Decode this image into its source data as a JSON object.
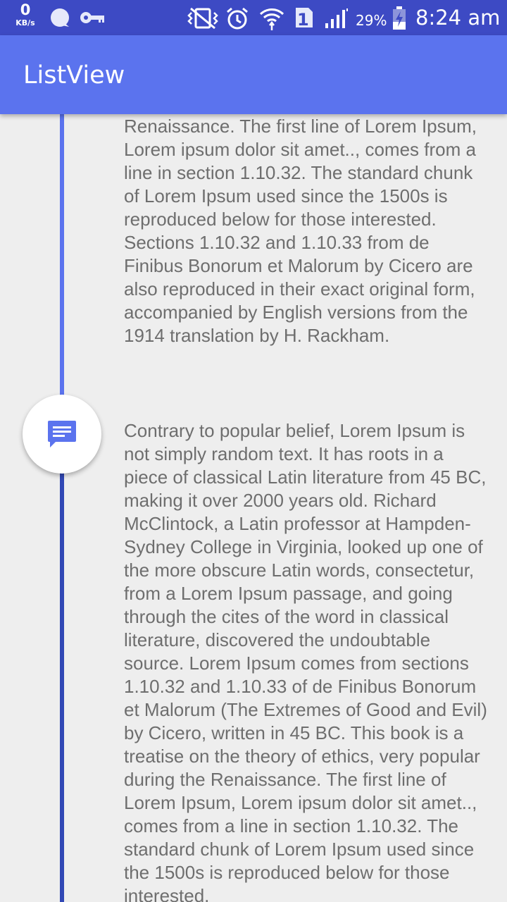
{
  "status_bar": {
    "net_speed": "0",
    "net_speed_unit": "KB/s",
    "sim_slot": "1",
    "battery_percent": "29%",
    "time": "8:24 am",
    "icons": [
      "chat-bubble-icon",
      "key-icon",
      "vibrate-icon",
      "alarm-icon",
      "wifi-icon",
      "sim-icon",
      "signal-icon",
      "battery-charging-icon"
    ],
    "color": "#3d4ac4"
  },
  "app_bar": {
    "title": "ListView",
    "color": "#5b73ee"
  },
  "timeline": {
    "line_color_top": "#5b73ee",
    "line_color_bottom": "#3148b5",
    "marker_icon": "message-icon",
    "items": [
      {
        "text": "Renaissance. The first line of Lorem Ipsum, Lorem ipsum dolor sit amet.., comes from a line in section 1.10.32. The standard chunk of Lorem Ipsum used since the 1500s is reproduced below for those interested. Sections 1.10.32 and 1.10.33 from de Finibus Bonorum et Malorum by Cicero are also reproduced in their exact original form, accompanied by English versions from the 1914 translation by H. Rackham."
      },
      {
        "text": "Contrary to popular belief, Lorem Ipsum is not simply random text. It has roots in a piece of classical Latin literature from 45 BC, making it over 2000 years old. Richard McClintock, a Latin professor at Hampden-Sydney College in Virginia, looked up one of the more obscure Latin words, consectetur, from a Lorem Ipsum passage, and going through the cites of the word in classical literature, discovered the undoubtable source. Lorem Ipsum comes from sections 1.10.32 and 1.10.33 of de Finibus Bonorum et Malorum (The Extremes of Good and Evil) by Cicero, written in 45 BC. This book is a treatise on the theory of ethics, very popular during the Renaissance. The first line of Lorem Ipsum, Lorem ipsum dolor sit amet.., comes from a line in section 1.10.32. The standard chunk of Lorem Ipsum used since the 1500s is reproduced below for those interested."
      }
    ]
  }
}
